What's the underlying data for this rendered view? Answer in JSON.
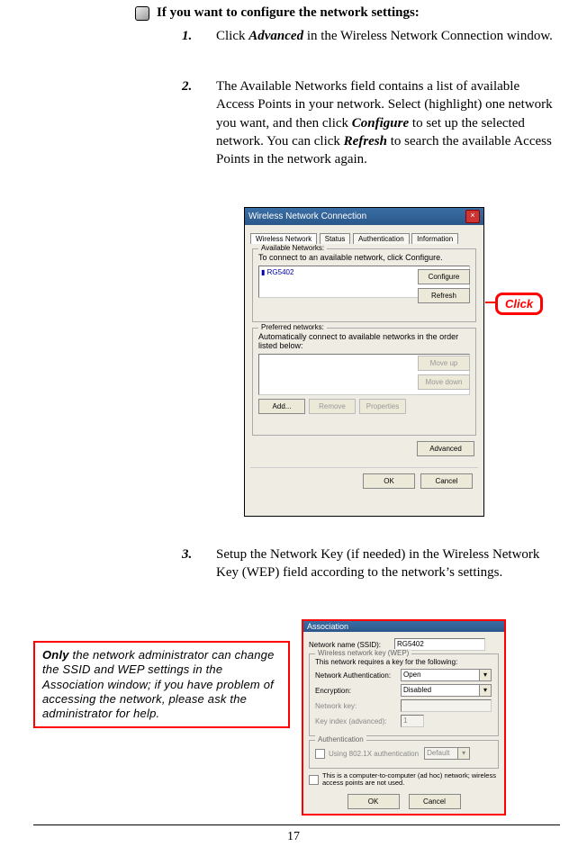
{
  "heading": "If you want to configure the network settings:",
  "steps": {
    "s1": {
      "num": "1.",
      "pre": "Click ",
      "bi": "Advanced",
      "post": " in the Wireless Network Connection window."
    },
    "s2": {
      "num": "2.",
      "t1": "The Available Networks field contains a list of available Access Points in your network.  Select (highlight) one network you want, and then click ",
      "bi1": "Configure",
      "t2": " to set up the selected network.  You can click ",
      "bi2": "Refresh",
      "t3": " to search the available Access Points in the network again."
    },
    "s3": {
      "num": "3.",
      "text": "Setup the Network Key (if needed) in the Wireless Network Key (WEP) field according to the network’s settings."
    }
  },
  "screenshot1": {
    "title": "Wireless Network Connection",
    "tabs": {
      "t1": "Wireless Network",
      "t2": "Status",
      "t3": "Authentication",
      "t4": "Information"
    },
    "avail": {
      "legend": "Available Networks:",
      "desc": "To connect to an available network, click Configure.",
      "item": "▮ RG5402",
      "configure": "Configure",
      "refresh": "Refresh"
    },
    "pref": {
      "legend": "Preferred networks:",
      "desc": "Automatically connect to available networks in the order listed below:",
      "moveup": "Move up",
      "movedown": "Move down",
      "add": "Add...",
      "remove": "Remove",
      "props": "Properties"
    },
    "advanced": "Advanced",
    "ok": "OK",
    "cancel": "Cancel"
  },
  "callouts": {
    "click": "Click"
  },
  "screenshot2": {
    "title": "Association",
    "ssid_lbl": "Network name (SSID):",
    "ssid_val": "RG5402",
    "wep_legend": "Wireless network key (WEP)",
    "wep_desc": "This network requires a key for the following:",
    "auth_lbl": "Network Authentication:",
    "auth_val": "Open",
    "enc_lbl": "Encryption:",
    "enc_val": "Disabled",
    "key_lbl": "Network key:",
    "idx_lbl": "Key index (advanced):",
    "idx_val": "1",
    "auth_legend": "Authentication",
    "auth_chk": "Using 802.1X authentication",
    "auth_sel": "Default",
    "adhoc": "This is a computer-to-computer (ad hoc) network; wireless access points are not used.",
    "ok": "OK",
    "cancel": "Cancel"
  },
  "admin_note": {
    "b": "Only",
    "rest": " the network administrator can change the SSID and WEP settings in the Association window; if you have problem of accessing the network, please ask the administrator for help."
  },
  "page_number": "17"
}
